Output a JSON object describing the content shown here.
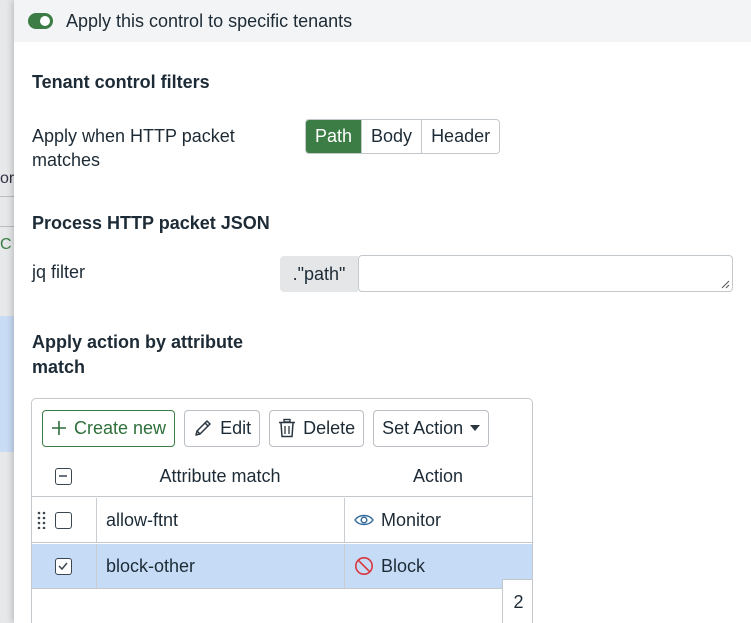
{
  "background": {
    "fragments": [
      "or",
      "C"
    ]
  },
  "top_bar": {
    "toggle_on": true,
    "label": "Apply this control to specific tenants"
  },
  "tenant_filters": {
    "title": "Tenant control filters",
    "match_label": "Apply when HTTP packet matches",
    "segments": [
      {
        "label": "Path",
        "active": true
      },
      {
        "label": "Body",
        "active": false
      },
      {
        "label": "Header",
        "active": false
      }
    ]
  },
  "json_section": {
    "title": "Process HTTP packet JSON",
    "jq_label": "jq filter",
    "jq_prefix": ".\"path\"",
    "jq_value": ""
  },
  "action_section": {
    "title": "Apply action by attribute match",
    "toolbar": {
      "create_label": "Create new",
      "edit_label": "Edit",
      "delete_label": "Delete",
      "set_action_label": "Set Action"
    },
    "columns": {
      "attribute": "Attribute match",
      "action": "Action"
    },
    "rows": [
      {
        "attribute": "allow-ftnt",
        "action": "Monitor",
        "action_icon": "eye-icon",
        "selected": false
      },
      {
        "attribute": "block-other",
        "action": "Block",
        "action_icon": "block-icon",
        "selected": true
      }
    ],
    "page_number": "2"
  },
  "colors": {
    "accent_green": "#3b7d45",
    "selected_row": "#c6dcf6",
    "block_red": "#d9363e",
    "monitor_blue": "#3a6fa0"
  }
}
